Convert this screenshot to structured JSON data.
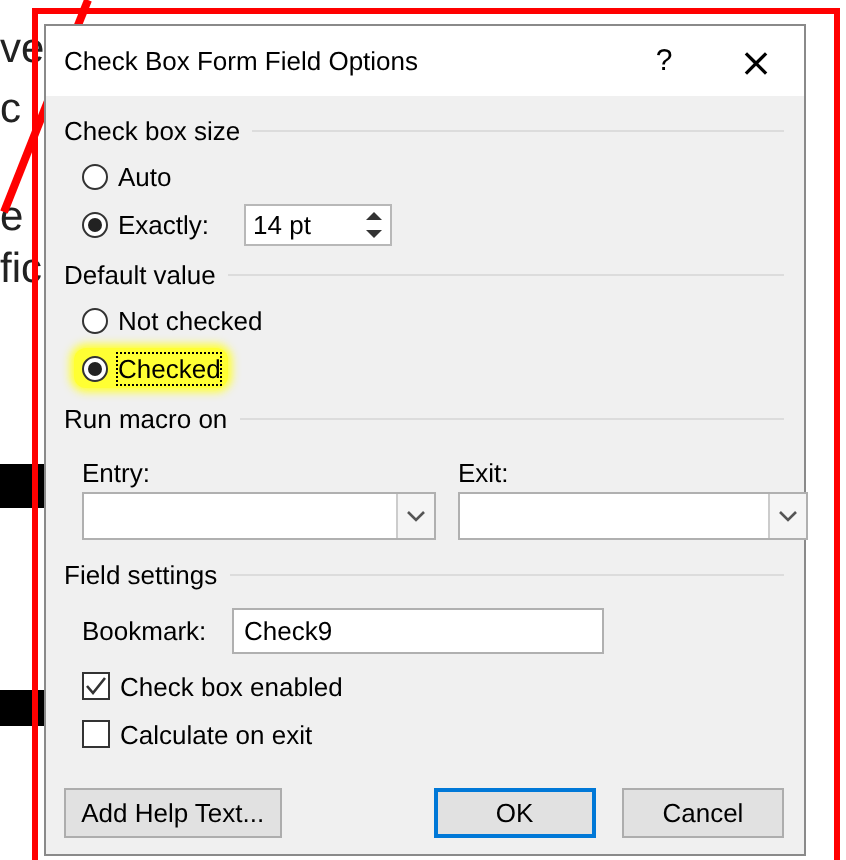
{
  "document": {
    "fragments": [
      "ve",
      "c",
      "e",
      "fic"
    ]
  },
  "dialog": {
    "title": "Check Box Form Field Options",
    "help_button": "?",
    "close_button": "×",
    "check_box_size": {
      "title": "Check box size",
      "options": [
        {
          "label": "Auto",
          "selected": false,
          "highlighted": false
        },
        {
          "label": "Exactly:",
          "selected": true,
          "highlighted": false
        }
      ],
      "size_value": "14 pt"
    },
    "default_value": {
      "title": "Default value",
      "options": [
        {
          "label": "Not checked",
          "selected": false,
          "highlighted": false
        },
        {
          "label": "Checked",
          "selected": true,
          "highlighted": true
        }
      ]
    },
    "run_macro_on": {
      "title": "Run macro on",
      "dropdowns": [
        {
          "label": "Entry:"
        },
        {
          "label": "Exit:"
        }
      ]
    },
    "field_settings": {
      "title": "Field settings",
      "bookmark": {
        "label": "Bookmark:",
        "value": "Check9"
      },
      "checkboxes": [
        {
          "label": "Check box enabled",
          "checked": true
        },
        {
          "label": "Calculate on exit",
          "checked": false
        }
      ]
    },
    "buttons": [
      {
        "label": "Add Help Text...",
        "default": false
      },
      {
        "label": "OK",
        "default": true
      },
      {
        "label": "Cancel",
        "default": false
      }
    ]
  }
}
